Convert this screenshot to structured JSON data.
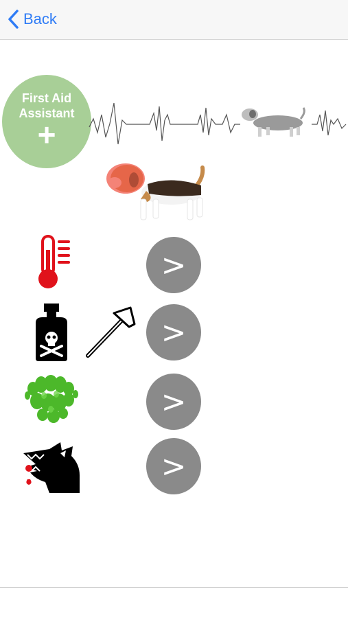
{
  "nav": {
    "back_label": "Back",
    "back_icon": "chevron-left-icon",
    "accent_color": "#2f7cf6"
  },
  "logo": {
    "title": "First Aid\nAssistant",
    "plus": "+",
    "color": "#a8cf97"
  },
  "hero": {
    "heartbeat_icon": "heartbeat-line-icon",
    "dog_icon": "beagle-dog-icon"
  },
  "rows": [
    {
      "icons": [
        "thermometer-icon"
      ],
      "button_label": ">"
    },
    {
      "icons": [
        "poison-bottle-icon",
        "nail-icon"
      ],
      "button_label": ">"
    },
    {
      "icons": [
        "vomit-icon"
      ],
      "button_label": ">"
    },
    {
      "icons": [
        "dog-bite-icon"
      ],
      "button_label": ">"
    }
  ],
  "button_color": "#8a8a8a"
}
